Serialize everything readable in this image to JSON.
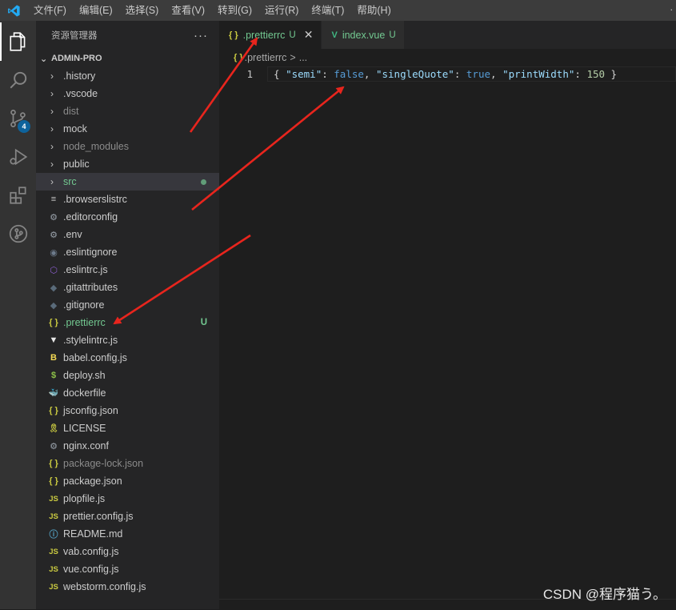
{
  "menu": [
    "文件(F)",
    "编辑(E)",
    "选择(S)",
    "查看(V)",
    "转到(G)",
    "运行(R)",
    "终端(T)",
    "帮助(H)"
  ],
  "menu_corner": ".",
  "activity": {
    "items": [
      "explorer-icon",
      "search-icon",
      "source-control-icon",
      "run-debug-icon",
      "extensions-icon",
      "git-graph-icon"
    ],
    "scm_badge": "4"
  },
  "sidebar": {
    "title": "资源管理器",
    "more": "···",
    "project": "ADMIN-PRO",
    "folders": [
      {
        "label": ".history"
      },
      {
        "label": ".vscode"
      },
      {
        "label": "dist"
      },
      {
        "label": "mock"
      },
      {
        "label": "node_modules"
      },
      {
        "label": "public"
      },
      {
        "label": "src"
      }
    ],
    "files": [
      {
        "label": ".browserslistrc",
        "icon": "≡"
      },
      {
        "label": ".editorconfig",
        "icon": "⚙"
      },
      {
        "label": ".env",
        "icon": "⚙"
      },
      {
        "label": ".eslintignore",
        "icon": "◉"
      },
      {
        "label": ".eslintrc.js",
        "icon": "⬡"
      },
      {
        "label": ".gitattributes",
        "icon": "◆"
      },
      {
        "label": ".gitignore",
        "icon": "◆"
      },
      {
        "label": ".prettierrc",
        "icon": "{ }",
        "status": "U"
      },
      {
        "label": ".stylelintrc.js",
        "icon": "▼"
      },
      {
        "label": "babel.config.js",
        "icon": "B"
      },
      {
        "label": "deploy.sh",
        "icon": "$"
      },
      {
        "label": "dockerfile",
        "icon": "🐳"
      },
      {
        "label": "jsconfig.json",
        "icon": "{ }"
      },
      {
        "label": "LICENSE",
        "icon": "🎗"
      },
      {
        "label": "nginx.conf",
        "icon": "⚙"
      },
      {
        "label": "package-lock.json",
        "icon": "{ }"
      },
      {
        "label": "package.json",
        "icon": "{ }"
      },
      {
        "label": "plopfile.js",
        "icon": "JS"
      },
      {
        "label": "prettier.config.js",
        "icon": "JS"
      },
      {
        "label": "README.md",
        "icon": "ⓘ"
      },
      {
        "label": "vab.config.js",
        "icon": "JS"
      },
      {
        "label": "vue.config.js",
        "icon": "JS"
      },
      {
        "label": "webstorm.config.js",
        "icon": "JS"
      }
    ]
  },
  "tabs": [
    {
      "label": ".prettierrc",
      "icon": "{ }",
      "status": "U",
      "close": "✕"
    },
    {
      "label": "index.vue",
      "icon": "V",
      "status": "U"
    }
  ],
  "breadcrumb": {
    "icon": "{ }",
    "file": ".prettierrc",
    "sep": ">",
    "more": "..."
  },
  "code": {
    "line_number": "1",
    "open": "{ ",
    "k1": "\"semi\"",
    "v1": "false",
    "k2": "\"singleQuote\"",
    "v2": "true",
    "k3": "\"printWidth\"",
    "v3": "150",
    "colon": ": ",
    "comma": ", ",
    "close": " }"
  },
  "watermark": "CSDN @程序猫う。",
  "colors": {
    "accent_blue": "#007acc",
    "untracked_green": "#73c991",
    "json_yellow": "#cbcb41",
    "vue_green": "#41b883",
    "annotation_arrow": "#e8251d"
  }
}
